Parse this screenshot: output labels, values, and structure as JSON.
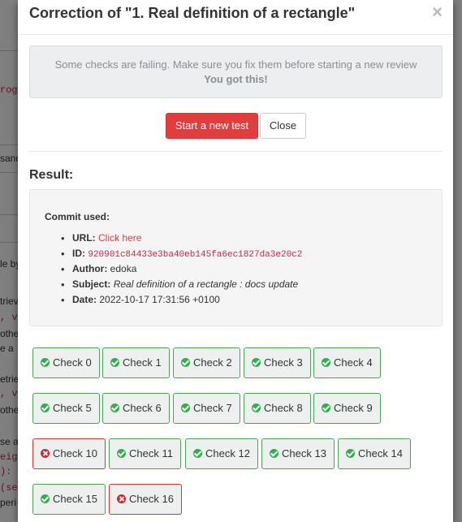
{
  "background": {
    "lines": [
      {
        "text": "rog",
        "color": "#c7254e"
      },
      {
        "text": "sand",
        "color": "#333"
      },
      {
        "text": "le by",
        "color": "#333"
      },
      {
        "text": "triev",
        "color": "#333"
      },
      {
        "text": ", val",
        "color": "#c7254e"
      },
      {
        "text": "other",
        "color": "#333"
      },
      {
        "text": "e a",
        "color": "#333"
      },
      {
        "text": "etrie",
        "color": "#333"
      },
      {
        "text": ", va",
        "color": "#c7254e"
      },
      {
        "text": "othe",
        "color": "#333"
      },
      {
        "text": "se a",
        "color": "#333"
      },
      {
        "text": "eigh",
        "color": "#c7254e"
      },
      {
        "text": "): t",
        "color": "#c7254e"
      },
      {
        "text": "(sel",
        "color": "#c7254e"
      },
      {
        "text": "peri",
        "color": "#333"
      }
    ]
  },
  "modal": {
    "title": "Correction of \"1. Real definition of a rectangle\"",
    "close_glyph": "×"
  },
  "alert": {
    "line1": "Some checks are failing. Make sure you fix them before starting a new review",
    "line2": "You got this!"
  },
  "actions": {
    "start_label": "Start a new test",
    "close_label": "Close"
  },
  "result": {
    "heading": "Result:",
    "commit_label": "Commit used:",
    "url_label": "URL:",
    "url_text": "Click here",
    "id_label": "ID:",
    "id_value": "920901c84433e3ba40eb145fa6ec1827da3e20c2",
    "author_label": "Author:",
    "author_value": "edoka",
    "subject_label": "Subject:",
    "subject_value": "Real definition of a rectangle : docs update",
    "date_label": "Date:",
    "date_value": "2022-10-17 17:31:56 +0100"
  },
  "checks": [
    {
      "label": "Check 0",
      "status": "pass"
    },
    {
      "label": "Check 1",
      "status": "pass"
    },
    {
      "label": "Check 2",
      "status": "pass"
    },
    {
      "label": "Check 3",
      "status": "pass"
    },
    {
      "label": "Check 4",
      "status": "pass"
    },
    {
      "label": "Check 5",
      "status": "pass"
    },
    {
      "label": "Check 6",
      "status": "pass"
    },
    {
      "label": "Check 7",
      "status": "pass"
    },
    {
      "label": "Check 8",
      "status": "pass"
    },
    {
      "label": "Check 9",
      "status": "pass"
    },
    {
      "label": "Check 10",
      "status": "fail"
    },
    {
      "label": "Check 11",
      "status": "pass"
    },
    {
      "label": "Check 12",
      "status": "pass"
    },
    {
      "label": "Check 13",
      "status": "pass"
    },
    {
      "label": "Check 14",
      "status": "pass"
    },
    {
      "label": "Check 15",
      "status": "pass"
    },
    {
      "label": "Check 16",
      "status": "fail"
    }
  ],
  "colors": {
    "danger": "#e23c3c",
    "pass_border": "#4ca45c",
    "pass_icon": "#2db24a",
    "fail_icon": "#d9232d"
  }
}
